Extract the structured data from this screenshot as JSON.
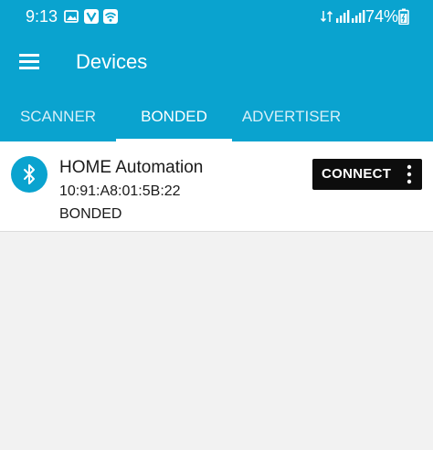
{
  "status_bar": {
    "time": "9:13",
    "battery": "74%",
    "icons": [
      "gallery-icon",
      "vpn-icon",
      "wifi-icon",
      "data-arrows-icon",
      "signal-icon",
      "signal-icon",
      "battery-icon"
    ]
  },
  "app_bar": {
    "title": "Devices",
    "menu_icon": "hamburger-menu-icon"
  },
  "tabs": [
    {
      "label": "SCANNER",
      "active": false
    },
    {
      "label": "BONDED",
      "active": true
    },
    {
      "label": "ADVERTISER",
      "active": false
    }
  ],
  "devices": [
    {
      "icon": "bluetooth-icon",
      "name": "HOME Automation",
      "address": "10:91:A8:01:5B:22",
      "state": "BONDED",
      "action_label": "CONNECT",
      "more_icon": "more-vertical-icon"
    }
  ],
  "colors": {
    "primary": "#0aa3cf",
    "background": "#f2f2f2",
    "button": "#0d0d0d",
    "text": "#1a1a1a"
  }
}
